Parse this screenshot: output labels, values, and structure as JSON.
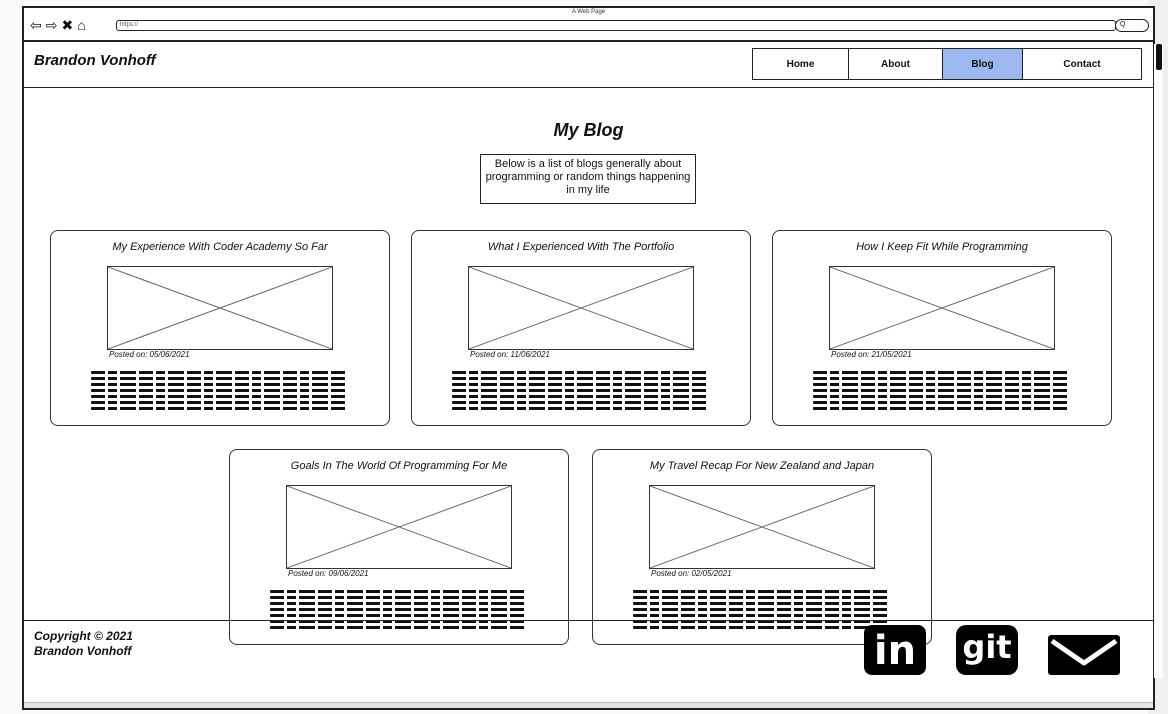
{
  "browser": {
    "window_title": "A Web Page",
    "url": "https://",
    "nav_icons": [
      "back-icon",
      "forward-icon",
      "close-icon",
      "home-icon"
    ],
    "search_glyph": "Q"
  },
  "header": {
    "site_name": "Brandon Vonhoff",
    "nav": [
      {
        "label": "Home",
        "active": false
      },
      {
        "label": "About",
        "active": false
      },
      {
        "label": "Blog",
        "active": true
      },
      {
        "label": "Contact",
        "active": false
      }
    ],
    "active_color": "#9cb8f0"
  },
  "main": {
    "title": "My Blog",
    "intro": "Below is a list of blogs generally about programming or random things happening in my life",
    "posts": [
      {
        "title": "My Experience With Coder Academy So Far",
        "date": "Posted on: 05/06/2021"
      },
      {
        "title": "What I Experienced With The Portfolio",
        "date": "Posted on: 11/06/2021"
      },
      {
        "title": "How I Keep Fit While Programming",
        "date": "Posted on: 21/05/2021"
      },
      {
        "title": "Goals In The World Of Programming For Me",
        "date": "Posted on: 09/06/2021"
      },
      {
        "title": "My Travel Recap For New Zealand and Japan",
        "date": "Posted on: 02/05/2021"
      }
    ]
  },
  "footer": {
    "copyright_line1": "Copyright © 2021",
    "copyright_line2": "Brandon Vonhoff",
    "linkedin_label": "in",
    "git_label": "git",
    "icons": [
      "linkedin-icon",
      "git-icon",
      "mail-icon"
    ]
  }
}
